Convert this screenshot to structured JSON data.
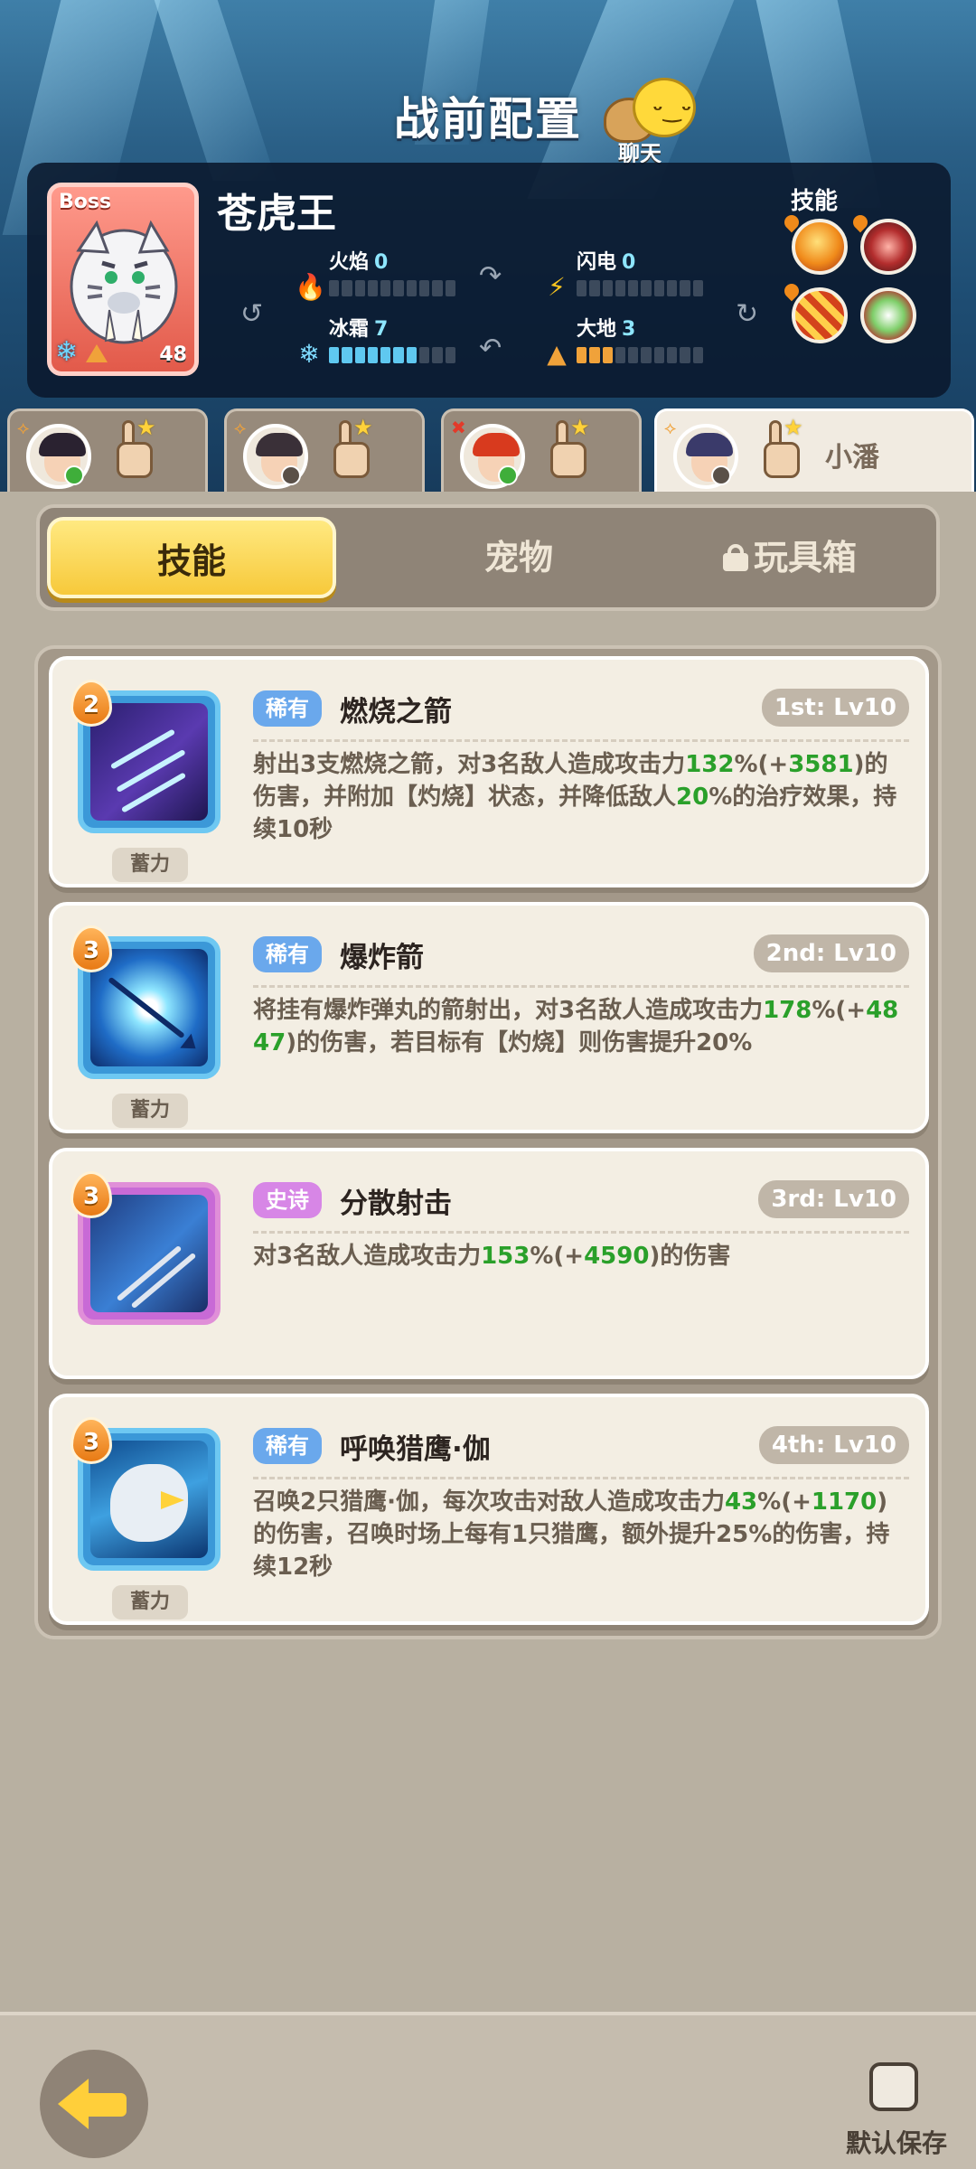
{
  "header": {
    "title": "战前配置",
    "chat_label": "聊天"
  },
  "boss": {
    "tag": "Boss",
    "name": "苍虎王",
    "level": "48",
    "skills_label": "技能",
    "elements": [
      {
        "name": "火焰",
        "value": "0",
        "filled": 0,
        "icon": "fire-icon",
        "color": "#e33a2a"
      },
      {
        "name": "闪电",
        "value": "0",
        "filled": 0,
        "icon": "lightning-icon",
        "color": "#f6c31f"
      },
      {
        "name": "冰霜",
        "value": "7",
        "filled": 7,
        "icon": "snowflake-icon",
        "color": "#5fc8f0"
      },
      {
        "name": "大地",
        "value": "3",
        "filled": 3,
        "icon": "earth-icon",
        "color": "#f0a23a"
      }
    ],
    "bar_segments": 10
  },
  "heroes": [
    {
      "name": "",
      "active": false,
      "badge_color": "#3fae3a",
      "hair": "#2a2230"
    },
    {
      "name": "",
      "active": false,
      "badge_color": "#5a5048",
      "hair": "#3a3038"
    },
    {
      "name": "",
      "active": false,
      "badge_color": "#3fae3a",
      "hair": "#d83a1e"
    },
    {
      "name": "小潘",
      "active": true,
      "badge_color": "#5a5048",
      "hair": "#3a3a6a"
    }
  ],
  "tabs": {
    "skills": "技能",
    "pets": "宠物",
    "toybox": "玩具箱"
  },
  "cards": [
    {
      "cost": "2",
      "rarity": "稀有",
      "rarity_type": "rare",
      "name": "燃烧之箭",
      "slot": "1st: Lv10",
      "charge": "蓄力",
      "desc": [
        {
          "t": "射出3支燃烧之箭，对3名敌人造成攻击力"
        },
        {
          "t": "132",
          "g": true
        },
        {
          "t": "%(+"
        },
        {
          "t": "3581",
          "g": true
        },
        {
          "t": ")的伤害，并附加【灼烧】状态，并降低敌人"
        },
        {
          "t": "20",
          "g": true
        },
        {
          "t": "%的治疗效果，持续10秒"
        }
      ]
    },
    {
      "cost": "3",
      "rarity": "稀有",
      "rarity_type": "rare",
      "name": "爆炸箭",
      "slot": "2nd: Lv10",
      "charge": "蓄力",
      "desc": [
        {
          "t": "将挂有爆炸弹丸的箭射出，对3名敌人造成攻击力"
        },
        {
          "t": "178",
          "g": true
        },
        {
          "t": "%(+"
        },
        {
          "t": "4847",
          "g": true
        },
        {
          "t": ")的伤害，若目标有【灼烧】则伤害提升20%"
        }
      ]
    },
    {
      "cost": "3",
      "rarity": "史诗",
      "rarity_type": "epic",
      "name": "分散射击",
      "slot": "3rd: Lv10",
      "charge": "",
      "desc": [
        {
          "t": "对3名敌人造成攻击力"
        },
        {
          "t": "153",
          "g": true
        },
        {
          "t": "%(+"
        },
        {
          "t": "4590",
          "g": true
        },
        {
          "t": ")的伤害"
        }
      ]
    },
    {
      "cost": "3",
      "rarity": "稀有",
      "rarity_type": "rare",
      "name": "呼唤猎鹰·伽",
      "slot": "4th: Lv10",
      "charge": "蓄力",
      "desc": [
        {
          "t": "召唤2只猎鹰·伽，每次攻击对敌人造成攻击力"
        },
        {
          "t": "43",
          "g": true
        },
        {
          "t": "%(+"
        },
        {
          "t": "1170",
          "g": true
        },
        {
          "t": ")的伤害，召唤时场上每有1只猎鹰，额外提升25%的伤害，持续12秒"
        }
      ]
    }
  ],
  "footer": {
    "default_save": "默认保存"
  }
}
